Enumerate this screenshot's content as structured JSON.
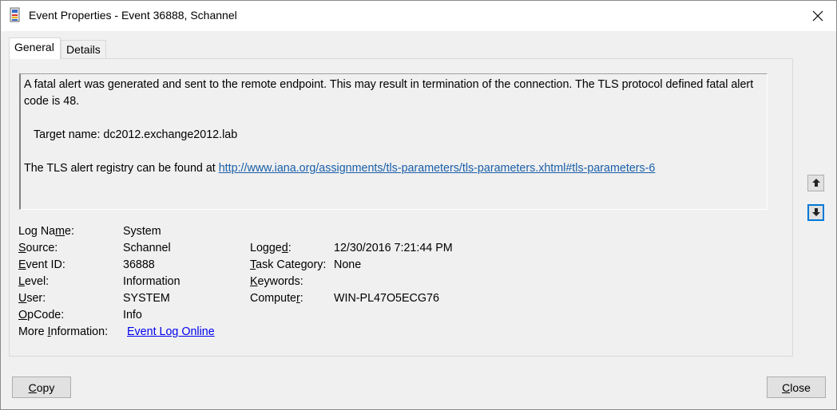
{
  "window": {
    "title": "Event Properties - Event 36888, Schannel"
  },
  "tabs": [
    {
      "label": "General",
      "active": true
    },
    {
      "label": "Details",
      "active": false
    }
  ],
  "description": {
    "line1": "A fatal alert was generated and sent to the remote endpoint. This may result in termination of the connection. The TLS protocol defined fatal alert code is 48.",
    "target": "Target name: dc2012.exchange2012.lab",
    "registry_prefix": "The TLS alert registry can be found at",
    "registry_link": "http://www.iana.org/assignments/tls-parameters/tls-parameters.xhtml#tls-parameters-6"
  },
  "fields": {
    "log_name": {
      "label_pre": "Log Na",
      "label_ul": "m",
      "label_post": "e:",
      "value": "System"
    },
    "source": {
      "label_pre": "",
      "label_ul": "S",
      "label_post": "ource:",
      "value": "Schannel"
    },
    "event_id": {
      "label_pre": "",
      "label_ul": "E",
      "label_post": "vent ID:",
      "value": "36888"
    },
    "level": {
      "label_pre": "",
      "label_ul": "L",
      "label_post": "evel:",
      "value": "Information"
    },
    "user": {
      "label_pre": "",
      "label_ul": "U",
      "label_post": "ser:",
      "value": "SYSTEM"
    },
    "opcode": {
      "label_pre": "",
      "label_ul": "O",
      "label_post": "pCode:",
      "value": "Info"
    },
    "more_info": {
      "label_pre": "More ",
      "label_ul": "I",
      "label_post": "nformation:",
      "value": "Event Log Online "
    },
    "logged": {
      "label_pre": "Logge",
      "label_ul": "d",
      "label_post": ":",
      "value": "12/30/2016 7:21:44 PM"
    },
    "task_category": {
      "label_pre": "",
      "label_ul": "T",
      "label_post": "ask Category:",
      "value": "None"
    },
    "keywords": {
      "label_pre": "",
      "label_ul": "K",
      "label_post": "eywords:",
      "value": ""
    },
    "computer": {
      "label_pre": "Compute",
      "label_ul": "r",
      "label_post": ":",
      "value": "WIN-PL47O5ECG76"
    }
  },
  "buttons": {
    "copy_pre": "",
    "copy_ul": "C",
    "copy_post": "opy",
    "close_pre": "",
    "close_ul": "C",
    "close_post": "lose"
  },
  "icons": [
    "event-viewer-icon",
    "close-icon",
    "arrow-up-icon",
    "arrow-down-icon"
  ]
}
